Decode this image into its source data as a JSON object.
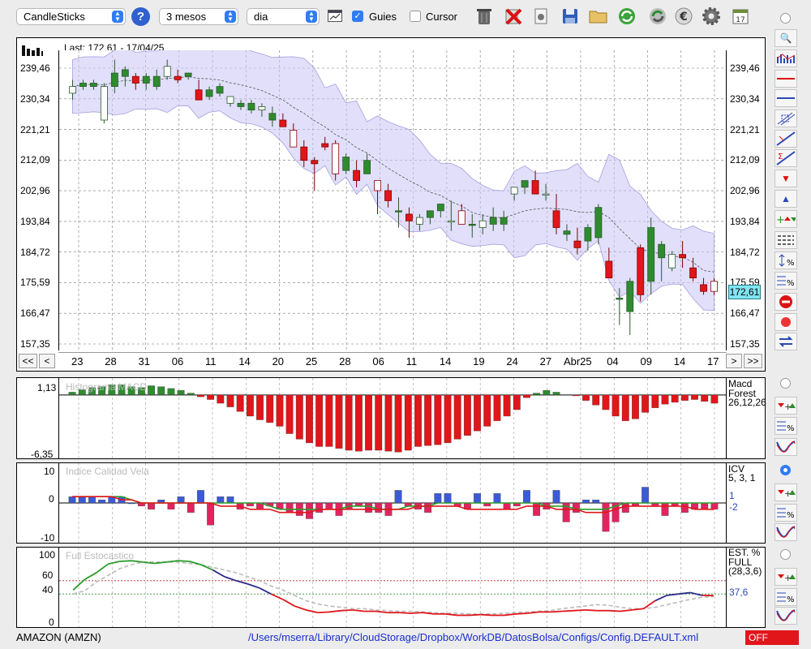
{
  "toolbar": {
    "chart_type": "CandleSticks",
    "period": "3 mesos",
    "interval": "dia",
    "guides_label": "Guies",
    "guides_checked": true,
    "cursor_label": "Cursor",
    "cursor_checked": false
  },
  "main": {
    "last": "Last: 172.61 - 17/04/25",
    "price_badge": "172,61",
    "ylim": [
      157.35,
      239.46
    ],
    "y_ticks": [
      "239,46",
      "230,34",
      "221,21",
      "212,09",
      "202,96",
      "193,84",
      "184,72",
      "175,59",
      "166,47",
      "157,35"
    ],
    "x_labels": [
      "23",
      "28",
      "31",
      "06",
      "11",
      "14",
      "20",
      "25",
      "28",
      "06",
      "11",
      "14",
      "19",
      "24",
      "27",
      "Abr25",
      "04",
      "09",
      "14",
      "17"
    ],
    "nav": {
      "first": "<<",
      "prev": "<",
      "next": ">",
      "last": ">>"
    }
  },
  "macd": {
    "title": "Histograma MACD",
    "name": "Macd Forest",
    "params": "26,12,26",
    "y_top": "1,13",
    "y_bottom": "-6,35"
  },
  "icv": {
    "title": "Indice Calidad Vela",
    "name": "ICV",
    "params": "5, 3, 1",
    "y_labels": [
      "10",
      "0",
      "-10"
    ],
    "value1": "1",
    "value2": "-2"
  },
  "stoch": {
    "title": "Full Estocastico",
    "name": "EST. % FULL",
    "params": "(28,3,6)",
    "y_labels": [
      "100",
      "60",
      "40",
      "0"
    ],
    "value": "37,6"
  },
  "status": {
    "symbol": "AMAZON (AMZN)",
    "path": "/Users/mserra/Library/CloudStorage/Dropbox/WorkDB/DatosBolsa/Configs/Config.DEFAULT.xml",
    "badge": "OFF"
  },
  "colors": {
    "up": "#2e8b2e",
    "down": "#e0161a",
    "band": "#c9c4f5",
    "accent": "#2f7cf6"
  },
  "chart_data": [
    {
      "type": "candlestick",
      "ylim": [
        157.35,
        239.46
      ],
      "x": [
        "23",
        "28",
        "31",
        "06",
        "11",
        "14",
        "20",
        "25",
        "28",
        "06",
        "11",
        "14",
        "19",
        "24",
        "27",
        "Abr25",
        "04",
        "09",
        "14",
        "17"
      ],
      "ohlc": [
        [
          232,
          236,
          230,
          234
        ],
        [
          234,
          236,
          233,
          235
        ],
        [
          234,
          236,
          233,
          235
        ],
        [
          224,
          235,
          223,
          234
        ],
        [
          234,
          242,
          232,
          238
        ],
        [
          237,
          240,
          234,
          239
        ],
        [
          237,
          238,
          233,
          235
        ],
        [
          235,
          238,
          233,
          237
        ],
        [
          234,
          239,
          233,
          237
        ],
        [
          237,
          242,
          236,
          240
        ],
        [
          237,
          239,
          235,
          236
        ],
        [
          237,
          238,
          236,
          238
        ],
        [
          233,
          236,
          231,
          230
        ],
        [
          231,
          234,
          230,
          233
        ],
        [
          232,
          235,
          231,
          234
        ],
        [
          229,
          231,
          228,
          231
        ],
        [
          228,
          230,
          227,
          229
        ],
        [
          227,
          230,
          226,
          229
        ],
        [
          227,
          229,
          225,
          228
        ],
        [
          224,
          228,
          222,
          226
        ],
        [
          224,
          226,
          222,
          222
        ],
        [
          221,
          223,
          216,
          216
        ],
        [
          216,
          218,
          210,
          212
        ],
        [
          212,
          213,
          203,
          211
        ],
        [
          217,
          219,
          215,
          216
        ],
        [
          217,
          218,
          206,
          208
        ],
        [
          209,
          214,
          208,
          213
        ],
        [
          209,
          212,
          204,
          206
        ],
        [
          208,
          214,
          208,
          212
        ],
        [
          206,
          206,
          196,
          203
        ],
        [
          203,
          205,
          198,
          200
        ],
        [
          197,
          201,
          192,
          197
        ],
        [
          196,
          198,
          189,
          194
        ],
        [
          193,
          196,
          191,
          195
        ],
        [
          195,
          197,
          193,
          197
        ],
        [
          197,
          199,
          195,
          199
        ],
        [
          194,
          200,
          191,
          194
        ],
        [
          197,
          199,
          193,
          193
        ],
        [
          193,
          196,
          189,
          193
        ],
        [
          192,
          196,
          190,
          194
        ],
        [
          193,
          198,
          191,
          195
        ],
        [
          193,
          197,
          191,
          195
        ],
        [
          202,
          204,
          200,
          204
        ],
        [
          204,
          206,
          202,
          206
        ],
        [
          206,
          209,
          203,
          202
        ],
        [
          202,
          205,
          200,
          202
        ],
        [
          197,
          202,
          190,
          192
        ],
        [
          190,
          193,
          188,
          191
        ],
        [
          188,
          192,
          184,
          186
        ],
        [
          188,
          193,
          185,
          192
        ],
        [
          189,
          199,
          187,
          198
        ],
        [
          182,
          186,
          178,
          177
        ],
        [
          171,
          174,
          163,
          171
        ],
        [
          167,
          177,
          160,
          176
        ],
        [
          186,
          187,
          170,
          172
        ],
        [
          176,
          195,
          172,
          192
        ],
        [
          183,
          188,
          176,
          187
        ],
        [
          180,
          185,
          179,
          184
        ],
        [
          184,
          188,
          180,
          183
        ],
        [
          180,
          183,
          176,
          177
        ],
        [
          175,
          177,
          172,
          173
        ],
        [
          176,
          177,
          172,
          173
        ]
      ]
    },
    {
      "type": "bar",
      "name": "Macd Forest",
      "ylim": [
        -6.35,
        1.13
      ],
      "values": [
        0.3,
        0.6,
        0.8,
        0.9,
        1.1,
        1.1,
        0.9,
        0.8,
        1.0,
        0.9,
        0.7,
        0.5,
        0.2,
        -0.2,
        -0.5,
        -0.9,
        -1.3,
        -1.8,
        -2.3,
        -2.7,
        -3.0,
        -3.4,
        -4.2,
        -4.8,
        -5.2,
        -5.6,
        -5.6,
        -5.8,
        -6.0,
        -6.1,
        -6.0,
        -6.0,
        -6.1,
        -6.2,
        -6.0,
        -5.6,
        -5.5,
        -5.4,
        -5.2,
        -4.8,
        -4.4,
        -3.9,
        -3.4,
        -2.8,
        -2.3,
        -1.6,
        -0.3,
        0.2,
        0.5,
        0.3,
        0.0,
        -0.1,
        -0.6,
        -1.1,
        -1.6,
        -2.3,
        -2.8,
        -2.6,
        -1.9,
        -1.4,
        -1.0,
        -0.8,
        -0.6,
        -0.5,
        -0.7,
        -0.9
      ]
    },
    {
      "type": "bar+line",
      "name": "ICV",
      "ylim": [
        -10,
        10
      ],
      "values": [
        2,
        2,
        2,
        1,
        2,
        2,
        0,
        -1,
        -2,
        1,
        -2,
        2,
        -3,
        4,
        -7,
        2,
        2,
        -2,
        -1,
        -2,
        -1,
        -2,
        -3,
        -4,
        -5,
        -3,
        -2,
        -4,
        -2,
        -1,
        -3,
        -3,
        -4,
        4,
        -1,
        -2,
        -3,
        3,
        3,
        -1,
        -2,
        3,
        -1,
        3,
        -2,
        -1,
        4,
        -4,
        -2,
        4,
        -6,
        -3,
        1,
        1,
        -9,
        -6,
        -3,
        -1,
        5,
        -1,
        -4,
        -1,
        -3,
        -2,
        -2,
        -2
      ],
      "line1": [
        2,
        2,
        2,
        2,
        2,
        2,
        1,
        0,
        0,
        0,
        0,
        0,
        0,
        0,
        0,
        0,
        0,
        0,
        0,
        0,
        -1,
        -2,
        -2,
        -2,
        -2,
        -2,
        -2,
        -2,
        -1,
        -1,
        -1,
        -2,
        -2,
        -2,
        -1,
        -1,
        -1,
        0,
        0,
        0,
        0,
        0,
        0,
        0,
        0,
        0,
        0,
        0,
        -1,
        -1,
        -1,
        -2,
        -2,
        -2,
        -2,
        -1,
        0,
        0,
        0,
        0,
        0,
        0,
        0,
        0,
        0,
        0
      ],
      "line2": [
        2,
        2,
        2,
        2,
        2,
        1,
        1,
        0,
        0,
        0,
        0,
        0,
        0,
        0,
        0,
        -1,
        -1,
        -1,
        -2,
        -2,
        -2,
        -3,
        -3,
        -3,
        -3,
        -2,
        -2,
        -2,
        -2,
        -2,
        -2,
        -2,
        -2,
        -2,
        -2,
        -1,
        -1,
        -1,
        -1,
        -1,
        -2,
        -2,
        -2,
        -2,
        -2,
        -2,
        -1,
        -1,
        -1,
        -2,
        -2,
        -2,
        -3,
        -3,
        -3,
        -2,
        -1,
        -1,
        -1,
        -1,
        -1,
        -1,
        -1,
        -2,
        -2,
        -2
      ]
    },
    {
      "type": "line",
      "name": "EST. % FULL",
      "ylim": [
        0,
        100
      ],
      "k": [
        46,
        62,
        72,
        85,
        89,
        90,
        88,
        86,
        88,
        90,
        89,
        84,
        76,
        66,
        60,
        55,
        49,
        40,
        32,
        22,
        16,
        12,
        13,
        15,
        16,
        14,
        14,
        12,
        12,
        11,
        12,
        10,
        10,
        8,
        8,
        9,
        8,
        8,
        10,
        11,
        13,
        13,
        14,
        15,
        16,
        15,
        15,
        14,
        16,
        18,
        30,
        38,
        40,
        42,
        38,
        37.6
      ],
      "d": [
        40,
        45,
        58,
        68,
        78,
        84,
        88,
        88,
        88,
        88,
        86,
        84,
        80,
        76,
        72,
        66,
        60,
        52,
        46,
        38,
        30,
        25,
        22,
        20,
        18,
        18,
        16,
        15,
        14,
        14,
        13,
        12,
        11,
        11,
        10,
        10,
        10,
        11,
        12,
        13,
        14,
        15,
        18,
        20,
        22,
        24,
        23,
        20,
        18,
        18,
        20,
        24,
        28,
        32,
        35,
        36
      ],
      "guides": [
        60,
        40
      ]
    }
  ]
}
